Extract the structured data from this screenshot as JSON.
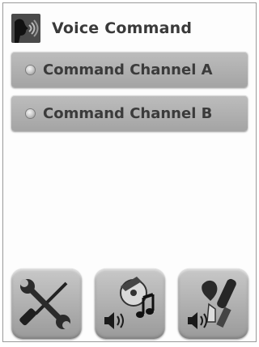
{
  "header": {
    "title": "Voice Command",
    "icon": "voice-command-icon"
  },
  "channels": [
    {
      "label": "Command Channel A",
      "indicator": "off"
    },
    {
      "label": "Command Channel B",
      "indicator": "off"
    }
  ],
  "toolbar": [
    {
      "icon": "tools-icon"
    },
    {
      "icon": "music-media-volume-icon"
    },
    {
      "icon": "microphone-volume-icon"
    }
  ]
}
